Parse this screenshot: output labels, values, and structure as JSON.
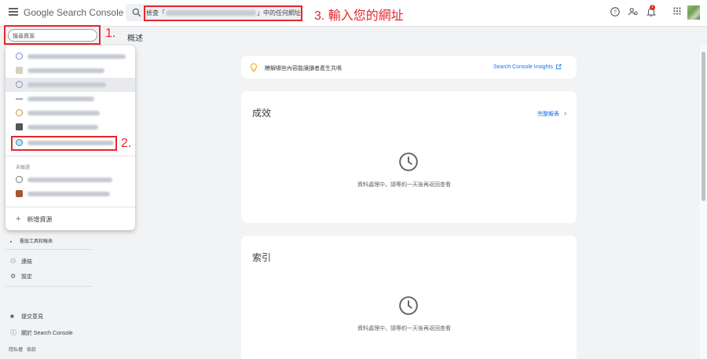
{
  "app": {
    "logo_google": "Google",
    "logo_product": "Search Console"
  },
  "search": {
    "prefix": "檢查「",
    "suffix": "」中的任何網址"
  },
  "annotations": {
    "step1": "1.",
    "step2": "2.",
    "step3": "3. 輸入您的網址"
  },
  "property_search": {
    "placeholder": "搜尋資源"
  },
  "tabs": {
    "overview": "概述"
  },
  "dropdown": {
    "category_label": "未驗證",
    "add_property": "新增資源"
  },
  "sidebar": {
    "legacy_tools": "舊版工具和報表",
    "links": "連結",
    "settings": "設定",
    "feedback": "提交意見",
    "about": "關於 Search Console",
    "privacy": "隱私權",
    "terms": "條款"
  },
  "insight_card": {
    "text": "瞭解哪些內容能讓讀者產生共鳴",
    "link": "Search Console Insights"
  },
  "performance_card": {
    "title": "成效",
    "report_link": "完整報表",
    "message": "資料處理中，請等約一天後再返回查看"
  },
  "index_card": {
    "title": "索引",
    "message": "資料處理中，請等約一天後再返回查看"
  },
  "colors": {
    "accent": "#1a73e8",
    "annotation_red": "#e8262b",
    "notification_red": "#d93025"
  },
  "icons": [
    "menu-icon",
    "search-icon",
    "help-icon",
    "manage-users-icon",
    "bell-icon",
    "apps-grid-icon",
    "bulb-icon",
    "open-external-icon",
    "chevron-right-icon",
    "clock-icon",
    "links-icon",
    "gear-icon",
    "feedback-icon",
    "info-icon",
    "plus-icon"
  ],
  "notifications": {
    "count": "1"
  }
}
